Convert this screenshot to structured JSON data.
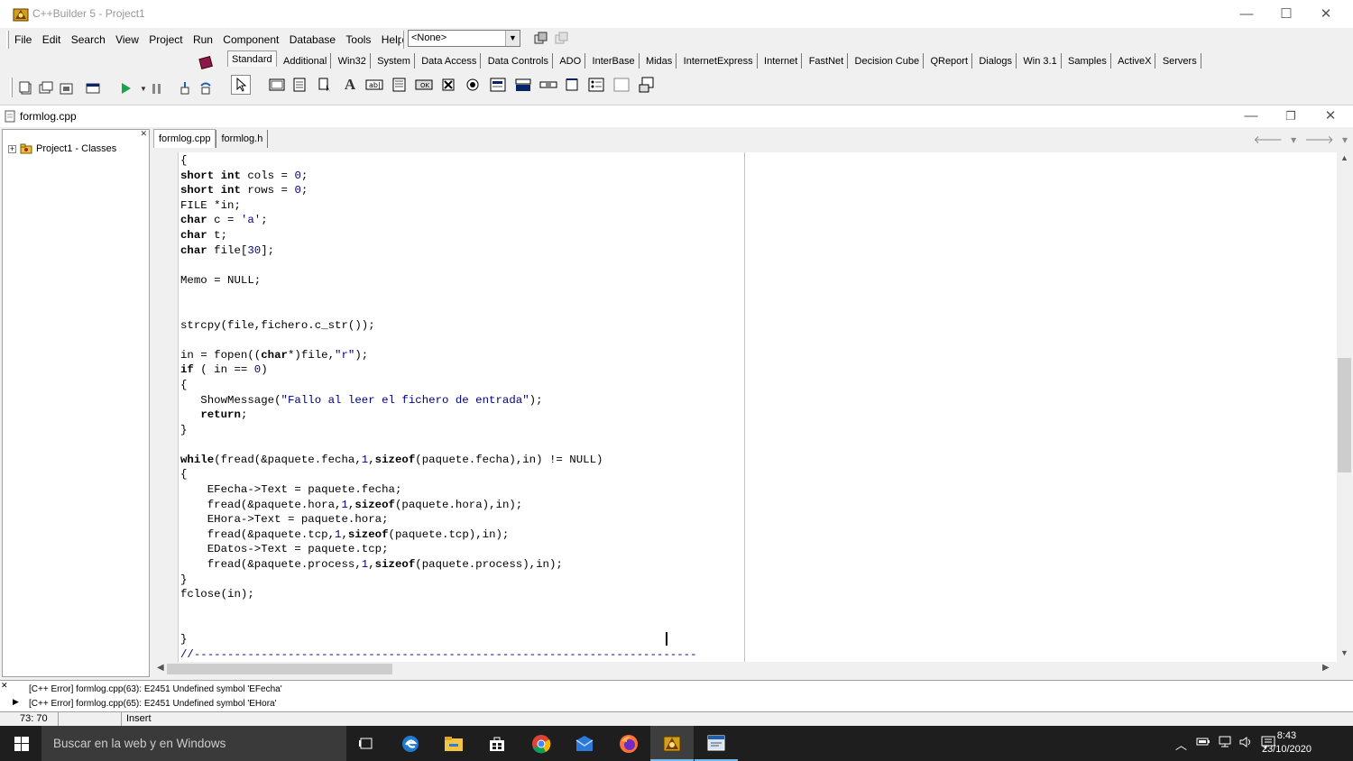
{
  "window": {
    "title": "C++Builder 5 - Project1",
    "controls": {
      "minimize": "—",
      "maximize": "☐",
      "close": "✕"
    }
  },
  "menu": [
    "File",
    "Edit",
    "Search",
    "View",
    "Project",
    "Run",
    "Component",
    "Database",
    "Tools",
    "Help"
  ],
  "toolbar": {
    "config_combo_value": "<None>"
  },
  "palette_tabs": [
    "Standard",
    "Additional",
    "Win32",
    "System",
    "Data Access",
    "Data Controls",
    "ADO",
    "InterBase",
    "Midas",
    "InternetExpress",
    "Internet",
    "FastNet",
    "Decision Cube",
    "QReport",
    "Dialogs",
    "Win 3.1",
    "Samples",
    "ActiveX",
    "Servers"
  ],
  "palette_active_tab": "Standard",
  "editor_window": {
    "title": "formlog.cpp",
    "controls": {
      "minimize": "—",
      "restore": "❐",
      "close": "✕"
    }
  },
  "class_explorer": {
    "root": "Project1 - Classes"
  },
  "file_tabs": [
    "formlog.cpp",
    "formlog.h"
  ],
  "active_file_tab": "formlog.cpp",
  "code_lines": [
    "{",
    "short int cols = 0;",
    "short int rows = 0;",
    "FILE *in;",
    "char c = 'a';",
    "char t;",
    "char file[30];",
    "",
    "Memo = NULL;",
    "",
    "",
    "strcpy(file,fichero.c_str());",
    "",
    "in = fopen((char*)file,\"r\");",
    "if ( in == 0)",
    "{",
    "   ShowMessage(\"Fallo al leer el fichero de entrada\");",
    "   return;",
    "}",
    "",
    "while(fread(&paquete.fecha,1,sizeof(paquete.fecha),in) != NULL)",
    "{",
    "    EFecha->Text = paquete.fecha;",
    "    fread(&paquete.hora,1,sizeof(paquete.hora),in);",
    "    EHora->Text = paquete.hora;",
    "    fread(&paquete.tcp,1,sizeof(paquete.tcp),in);",
    "    EDatos->Text = paquete.tcp;",
    "    fread(&paquete.process,1,sizeof(paquete.process),in);",
    "}",
    "fclose(in);",
    "",
    "",
    "}",
    "//---------------------------------------------------------------------------"
  ],
  "messages": [
    "[C++ Error] formlog.cpp(63): E2451 Undefined symbol 'EFecha'",
    "[C++ Error] formlog.cpp(65): E2451 Undefined symbol 'EHora'"
  ],
  "status": {
    "position": "73: 70",
    "mode": "Insert"
  },
  "taskbar": {
    "search_placeholder": "Buscar en la web y en Windows",
    "time": "8:43",
    "date": "23/10/2020"
  },
  "colors": {
    "string_literal": "#000080",
    "number_literal": "#000080",
    "taskbar_bg": "#1e1e1e",
    "active_indicator": "#76b9ed"
  }
}
